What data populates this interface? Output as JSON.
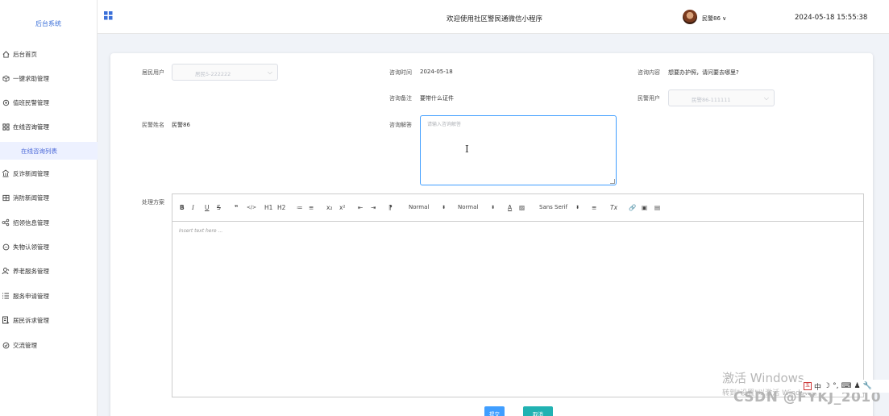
{
  "brand": "后台系统",
  "menu": [
    {
      "label": "后台首页",
      "icon": "home-icon"
    },
    {
      "label": "一键求助管理",
      "icon": "cube-icon"
    },
    {
      "label": "值班民警管理",
      "icon": "gear-icon"
    },
    {
      "label": "在线咨询管理",
      "icon": "grid-icon"
    },
    {
      "label": "反诈新闻管理",
      "icon": "bank-icon"
    },
    {
      "label": "消防新闻管理",
      "icon": "table-icon"
    },
    {
      "label": "招领信息管理",
      "icon": "share-icon"
    },
    {
      "label": "失物认领管理",
      "icon": "chat-icon"
    },
    {
      "label": "养老服务管理",
      "icon": "user-icon"
    },
    {
      "label": "服务申请管理",
      "icon": "list-icon"
    },
    {
      "label": "居民诉求管理",
      "icon": "doc-icon"
    },
    {
      "label": "交流管理",
      "icon": "check-circle-icon"
    }
  ],
  "submenu_active": "在线咨询列表",
  "header": {
    "welcome": "欢迎使用社区警民通微信小程序",
    "user": "民警86",
    "datetime": "2024-05-18 15:55:38"
  },
  "form": {
    "resident_label": "居民用户",
    "resident_value": "居民5-222222",
    "consult_time_label": "咨询时间",
    "consult_time_value": "2024-05-18",
    "consult_content_label": "咨询内容",
    "consult_content_value": "想要办护照，请问要去哪里?",
    "consult_note_label": "咨询备注",
    "consult_note_value": "要带什么证件",
    "police_user_label": "民警用户",
    "police_user_value": "民警86-111111",
    "police_name_label": "民警姓名",
    "police_name_value": "民警86",
    "answer_label": "咨询解答",
    "answer_placeholder": "请输入咨询解答",
    "plan_label": "处理方案"
  },
  "editor": {
    "placeholder": "Insert text here ...",
    "tools": [
      "B",
      "I",
      "U",
      "S",
      "❞",
      "</>",
      "H1",
      "H2",
      "≔",
      "≡",
      "x₂",
      "x²",
      "⇤",
      "⇥",
      "⁋",
      "Normal",
      "⬍",
      "Normal",
      "⬍",
      "A",
      "▨",
      "Sans Serif",
      "⬍",
      "≡",
      "Tx",
      "🔗",
      "▣",
      "▤"
    ]
  },
  "buttons": {
    "submit": "提交",
    "cancel": "取消"
  },
  "colors": {
    "accent": "#409eff",
    "brand": "#3a6fd8",
    "submit_bg": "#409eff",
    "cancel_bg": "#21b2b2"
  },
  "overlay": {
    "activate_windows": "激活 Windows",
    "activate_hint": "转到\"设置\"以激活 Windows。",
    "csdn": "CSDN @FYKJ_2010",
    "ime": "中"
  }
}
